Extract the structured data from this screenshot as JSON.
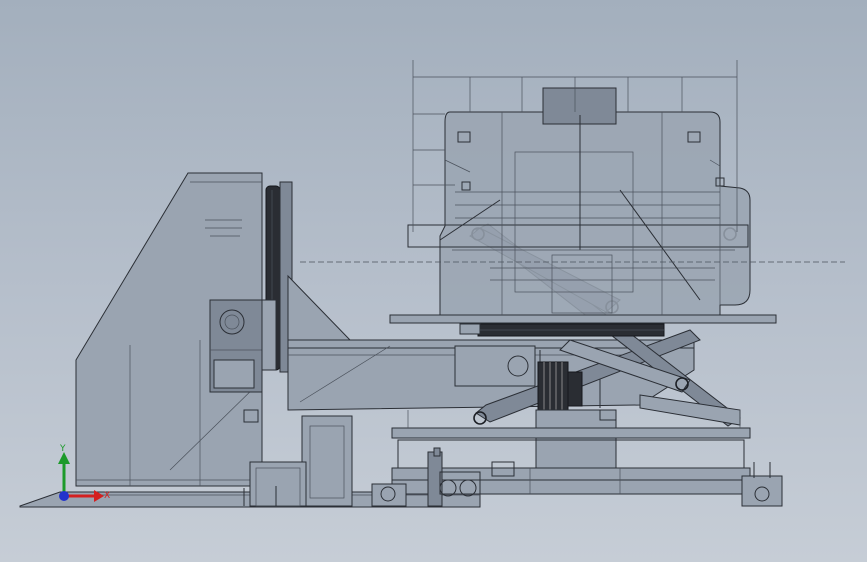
{
  "viewport": {
    "background_top": "#a3afbd",
    "background_bottom": "#c6cdd6"
  },
  "triad": {
    "x_label": "X",
    "y_label": "Y",
    "x_color": "#d42020",
    "y_color": "#1c9a2a",
    "z_color": "#2233cc"
  }
}
